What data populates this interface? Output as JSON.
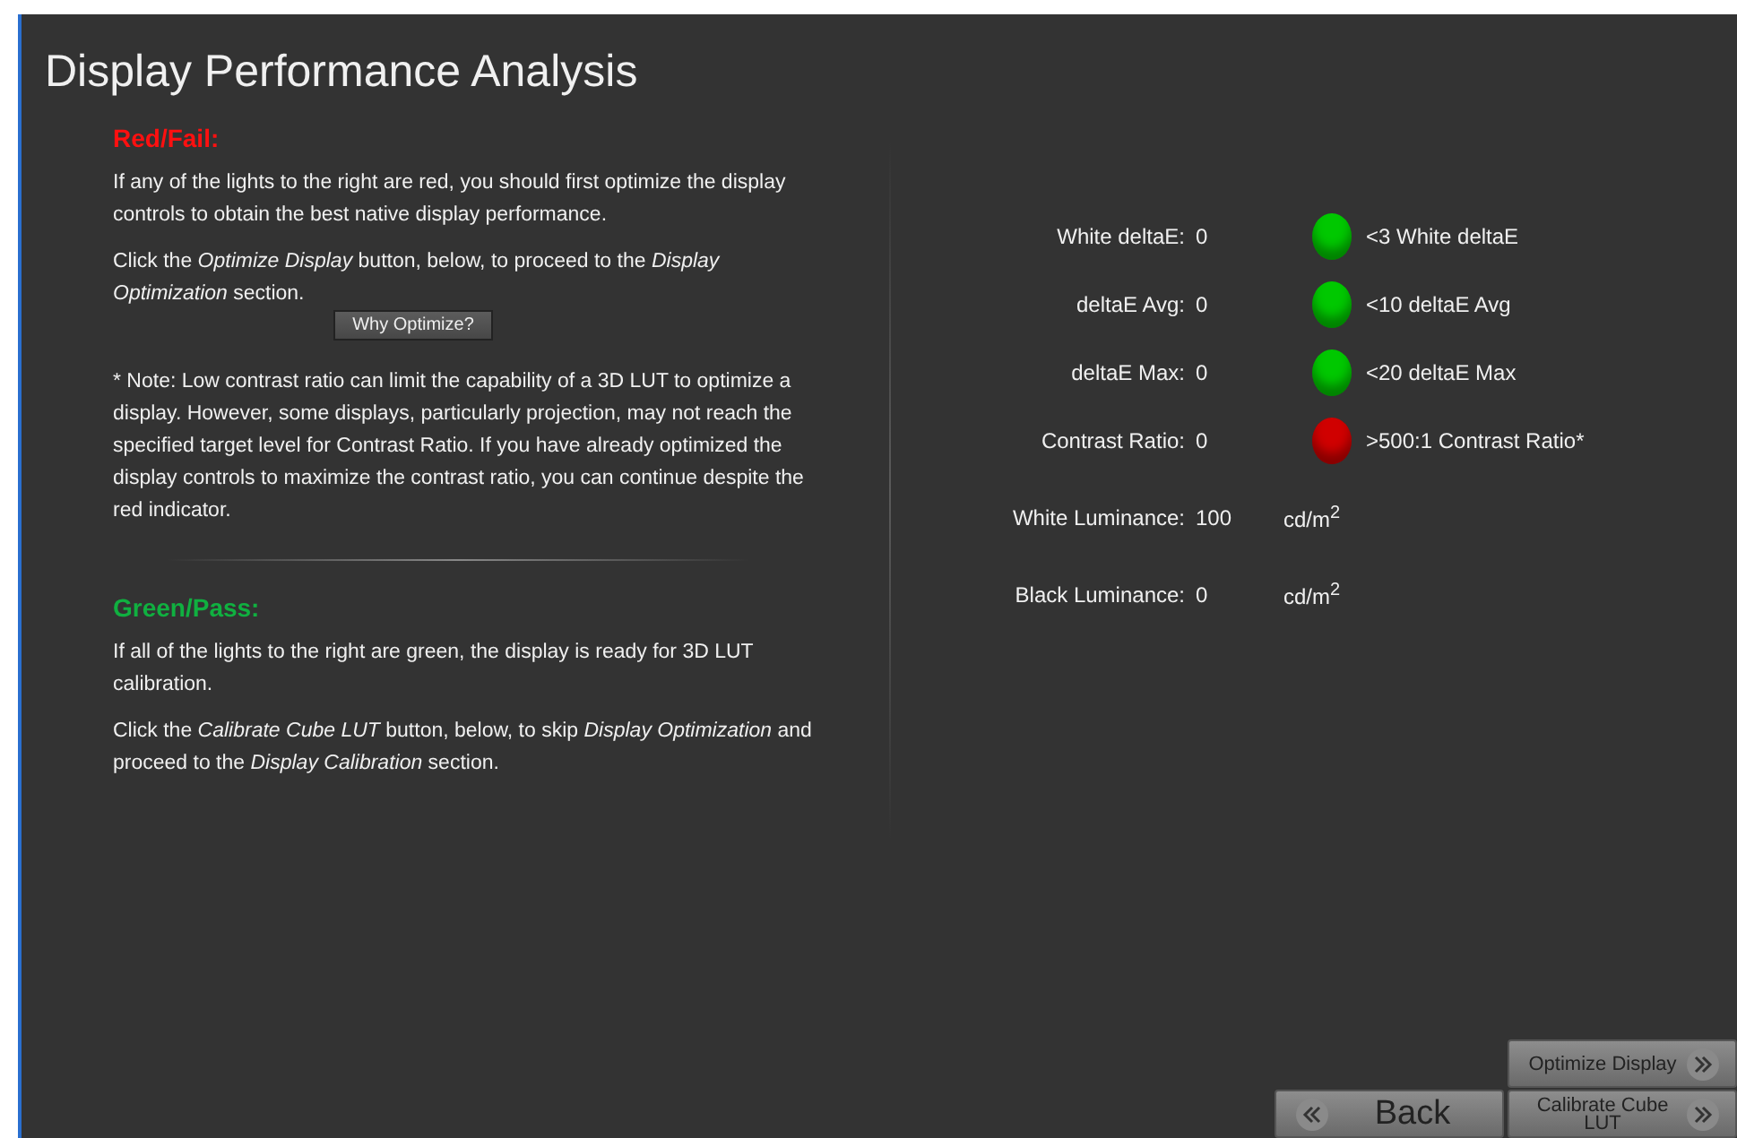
{
  "title": "Display Performance Analysis",
  "fail_section": {
    "heading": "Red/Fail:",
    "paragraphs": [
      "If any of the lights to the right are red, you should first optimize the display controls to obtain the best native display performance.",
      "Click the *Optimize Display* button, below, to proceed to the *Display Optimization* section."
    ],
    "button": "Why Optimize?",
    "note": "* Note: Low contrast ratio can limit the capability of a 3D LUT to optimize a display. However, some displays, particularly projection, may not reach the specified target level for Contrast Ratio.  If you have already optimized the display controls to maximize the contrast ratio, you can continue despite the red indicator."
  },
  "pass_section": {
    "heading": "Green/Pass:",
    "paragraphs": [
      "If all of the lights to the right are green, the display is ready for 3D LUT calibration.",
      "Click the *Calibrate Cube LUT* button, below, to skip *Display Optimization* and proceed to the *Display Calibration* section."
    ]
  },
  "metrics": [
    {
      "kind": "light",
      "label": "White deltaE:",
      "value": "0",
      "color": "#00c800",
      "target": "<3 White deltaE"
    },
    {
      "kind": "light",
      "label": "deltaE Avg:",
      "value": "0",
      "color": "#00c800",
      "target": "<10 deltaE Avg"
    },
    {
      "kind": "light",
      "label": "deltaE Max:",
      "value": "0",
      "color": "#00c800",
      "target": "<20 deltaE Max"
    },
    {
      "kind": "light",
      "label": "Contrast Ratio:",
      "value": "0",
      "color": "#d00000",
      "target": ">500:1 Contrast Ratio*"
    },
    {
      "kind": "unit",
      "label": "White Luminance:",
      "value": "100",
      "unit": "cd/m$^{2}$"
    },
    {
      "kind": "unit",
      "label": "Black Luminance:",
      "value": "0",
      "unit": "cd/m$^{2}$"
    }
  ],
  "buttons": {
    "optimize": "Optimize Display",
    "back": "Back",
    "calibrate": "Calibrate Cube LUT"
  }
}
